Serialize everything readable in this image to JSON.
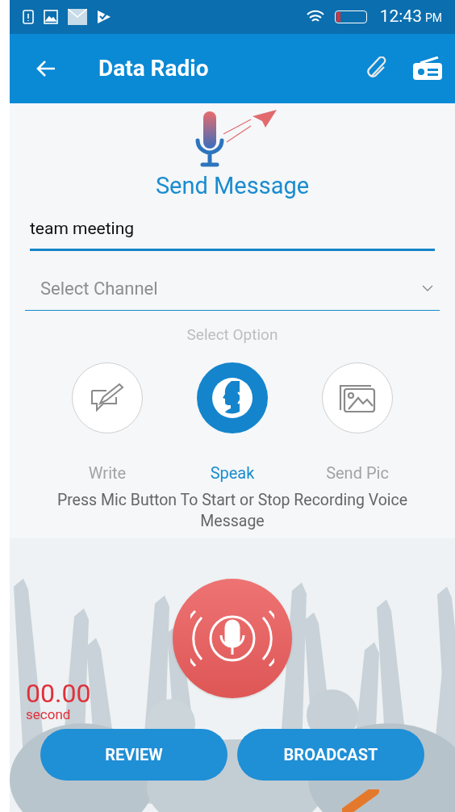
{
  "status_bar": {
    "time": "12:43",
    "ampm": "PM",
    "battery": {
      "level": 0.15
    }
  },
  "app_bar": {
    "title": "Data Radio"
  },
  "header": {
    "title": "Send Message"
  },
  "message_field": {
    "value": "team meeting"
  },
  "channel_select": {
    "placeholder": "Select Channel"
  },
  "options_label": "Select Option",
  "options": [
    {
      "kind": "write",
      "label": "Write",
      "selected": false
    },
    {
      "kind": "speak",
      "label": "Speak",
      "selected": true
    },
    {
      "kind": "pic",
      "label": "Send Pic",
      "selected": false
    }
  ],
  "instruction": "Press Mic Button To Start or Stop Recording Voice Message",
  "timer": {
    "value": "00.00",
    "unit": "second"
  },
  "buttons": [
    "REVIEW",
    "BROADCAST"
  ]
}
